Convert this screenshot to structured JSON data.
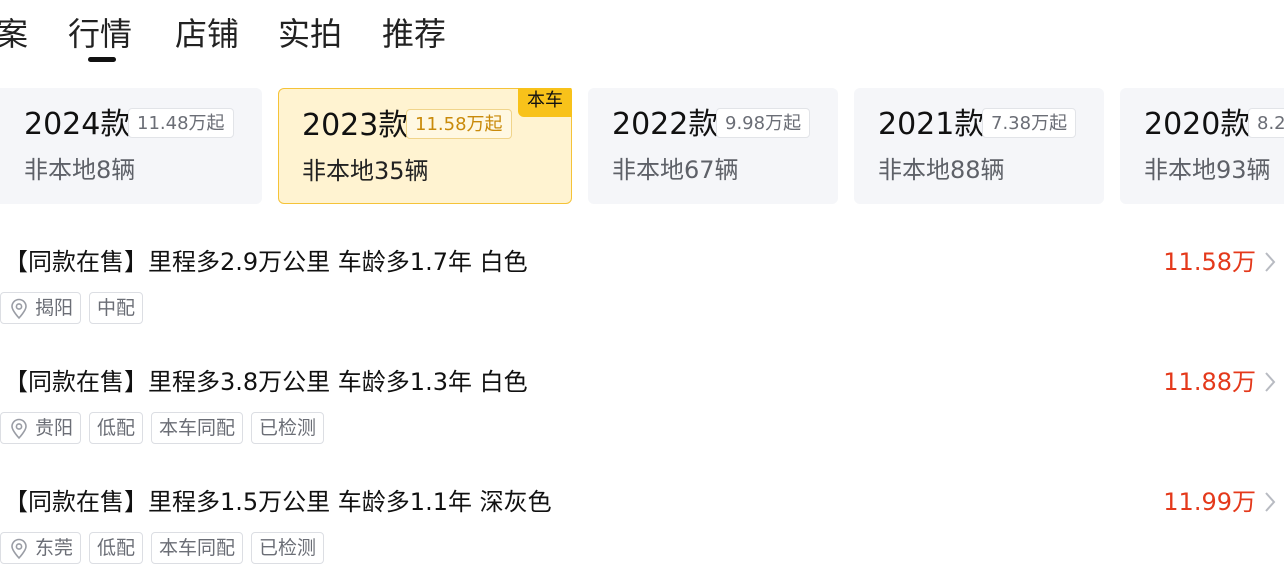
{
  "tabs": [
    {
      "label": "案",
      "active": false
    },
    {
      "label": "行情",
      "active": true
    },
    {
      "label": "店铺",
      "active": false
    },
    {
      "label": "实拍",
      "active": false
    },
    {
      "label": "推荐",
      "active": false
    }
  ],
  "year_cards": [
    {
      "year": "2024款",
      "price": "11.48万起",
      "count": "非本地8辆",
      "selected": false
    },
    {
      "year": "2023款",
      "price": "11.58万起",
      "count": "非本地35辆",
      "selected": true,
      "tag": "本车"
    },
    {
      "year": "2022款",
      "price": "9.98万起",
      "count": "非本地67辆",
      "selected": false
    },
    {
      "year": "2021款",
      "price": "7.38万起",
      "count": "非本地88辆",
      "selected": false
    },
    {
      "year": "2020款",
      "price": "8.2",
      "count": "非本地93辆",
      "selected": false
    }
  ],
  "listings": [
    {
      "title": "【同款在售】里程多2.9万公里 车龄多1.7年 白色",
      "price": "11.58万",
      "location": "揭阳",
      "tags": [
        "中配"
      ]
    },
    {
      "title": "【同款在售】里程多3.8万公里 车龄多1.3年 白色",
      "price": "11.88万",
      "location": "贵阳",
      "tags": [
        "低配",
        "本车同配",
        "已检测"
      ]
    },
    {
      "title": "【同款在售】里程多1.5万公里 车龄多1.1年 深灰色",
      "price": "11.99万",
      "location": "东莞",
      "tags": [
        "低配",
        "本车同配",
        "已检测"
      ]
    }
  ],
  "icons": {
    "location": "location-pin-icon",
    "arrow": "chevron-right-icon"
  },
  "colors": {
    "price": "#e4391b",
    "selected_card_bg": "#fff3d1",
    "selected_card_border": "#f5c338",
    "corner_tag_bg": "#f8c21a",
    "selected_price_text": "#c98a0a"
  }
}
